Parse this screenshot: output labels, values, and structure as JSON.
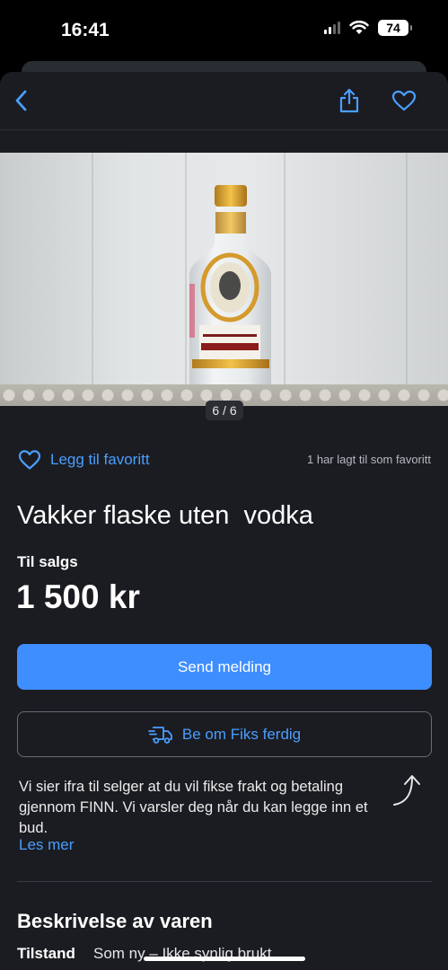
{
  "status_bar": {
    "time": "16:41",
    "battery": "74"
  },
  "nav": {
    "back_icon": "chevron-left-icon",
    "share_icon": "share-icon",
    "favorite_icon": "heart-icon"
  },
  "gallery": {
    "counter": "6 / 6"
  },
  "favorite": {
    "label": "Legg til favoritt",
    "count_text": "1 har lagt til som favoritt"
  },
  "listing": {
    "title": "Vakker flaske uten  vodka",
    "sale_label": "Til salgs",
    "price": "1 500 kr"
  },
  "actions": {
    "send_message": "Send melding",
    "fiks_ferdig": "Be om Fiks ferdig"
  },
  "info": {
    "text": "Vi sier ifra til selger at du vil fikse frakt og betaling gjennom FINN. Vi varsler deg når du kan legge inn et bud.",
    "read_more": "Les mer"
  },
  "description": {
    "heading": "Beskrivelse av varen",
    "condition_label": "Tilstand",
    "condition_value": "Som ny – Ikke synlig brukt"
  },
  "colors": {
    "accent": "#3e8eff",
    "link": "#4a9eff",
    "background": "#1b1c21"
  }
}
